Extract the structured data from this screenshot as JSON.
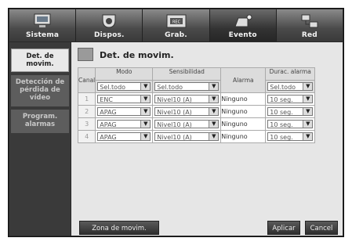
{
  "top_tabs": [
    {
      "label": "Sistema",
      "icon": "monitor-icon"
    },
    {
      "label": "Dispos.",
      "icon": "camera-icon"
    },
    {
      "label": "Grab.",
      "icon": "rec-icon"
    },
    {
      "label": "Evento",
      "icon": "event-camera-icon"
    },
    {
      "label": "Red",
      "icon": "network-icon"
    }
  ],
  "sidebar": {
    "items": [
      {
        "label": "Det. de movim.",
        "active": true
      },
      {
        "label": "Detección de pérdida de vídeo",
        "active": false
      },
      {
        "label": "Program. alarmas",
        "active": false
      }
    ]
  },
  "content": {
    "title": "Det. de movim.",
    "headers": {
      "canal": "Canal",
      "modo": "Modo",
      "sensibilidad": "Sensibilidad",
      "alarma": "Alarma",
      "durac": "Durac. alarma"
    },
    "select_all": {
      "modo": "Sel.todo",
      "sensibilidad": "Sel.todo",
      "durac": "Sel.todo"
    },
    "rows": [
      {
        "canal": "1",
        "modo": "ENC",
        "sensibilidad": "Nivel10 (A)",
        "alarma": "Ninguno",
        "durac": "10 seg."
      },
      {
        "canal": "2",
        "modo": "APAG",
        "sensibilidad": "Nivel10 (A)",
        "alarma": "Ninguno",
        "durac": "10 seg."
      },
      {
        "canal": "3",
        "modo": "APAG",
        "sensibilidad": "Nivel10 (A)",
        "alarma": "Ninguno",
        "durac": "10 seg."
      },
      {
        "canal": "4",
        "modo": "APAG",
        "sensibilidad": "Nivel10 (A)",
        "alarma": "Ninguno",
        "durac": "10 seg."
      }
    ],
    "buttons": {
      "zona": "Zona de movim.",
      "aplicar": "Aplicar",
      "cancel": "Cancel"
    }
  }
}
